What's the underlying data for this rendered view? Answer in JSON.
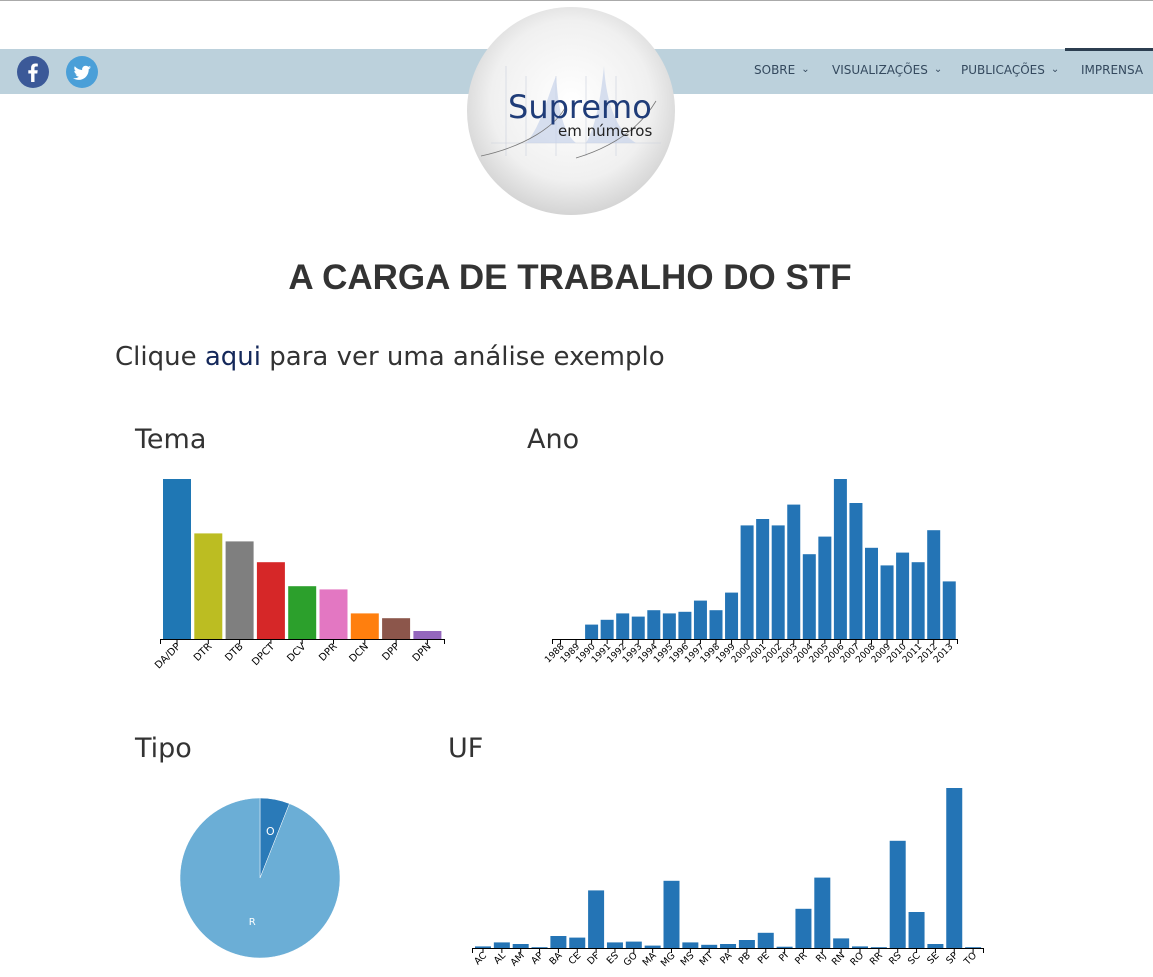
{
  "header": {
    "social": [
      {
        "name": "facebook"
      },
      {
        "name": "twitter"
      }
    ],
    "nav": [
      {
        "label": "SOBRE",
        "has_dropdown": true
      },
      {
        "label": "VISUALIZAÇÕES",
        "has_dropdown": true
      },
      {
        "label": "PUBLICAÇÕES",
        "has_dropdown": true
      },
      {
        "label": "IMPRENSA",
        "has_dropdown": false
      }
    ],
    "logo": {
      "line1": "Supremo",
      "line2": "em números"
    },
    "colors": {
      "navbar": "#bcd1dc",
      "nav_text": "#34495e",
      "facebook": "#3b5998",
      "twitter": "#4a9fd8"
    }
  },
  "page": {
    "title": "A CARGA DE TRABALHO DO STF",
    "intro_before": "Clique ",
    "intro_link": "aqui",
    "intro_after": " para ver uma análise exemplo"
  },
  "chart_data": [
    {
      "type": "bar",
      "title": "Tema",
      "categories": [
        "DA/DP",
        "DTR",
        "DTB",
        "DPCT",
        "DCV",
        "DPR",
        "DCN",
        "DPP",
        "DPN"
      ],
      "values": [
        100,
        66,
        61,
        48,
        33,
        31,
        16,
        13,
        5
      ],
      "colors": [
        "#1f77b4",
        "#bcbd22",
        "#7f7f7f",
        "#d62728",
        "#2ca02c",
        "#e377c2",
        "#ff7f0e",
        "#8c564b",
        "#9467bd"
      ],
      "ylim": [
        0,
        100
      ]
    },
    {
      "type": "bar",
      "title": "Ano",
      "categories": [
        "1988",
        "1989",
        "1990",
        "1991",
        "1992",
        "1993",
        "1994",
        "1995",
        "1996",
        "1997",
        "1998",
        "1999",
        "2000",
        "2001",
        "2002",
        "2003",
        "2004",
        "2005",
        "2006",
        "2007",
        "2008",
        "2009",
        "2010",
        "2011",
        "2012",
        "2013"
      ],
      "values": [
        0,
        0,
        9,
        12,
        16,
        14,
        18,
        16,
        17,
        24,
        18,
        29,
        71,
        75,
        71,
        84,
        53,
        64,
        100,
        85,
        57,
        46,
        54,
        48,
        68,
        36
      ],
      "color": "#2474b5",
      "ylim": [
        0,
        100
      ]
    },
    {
      "type": "pie",
      "title": "Tipo",
      "labels": [
        "O",
        "R"
      ],
      "values": [
        6,
        94
      ],
      "colors": [
        "#2a7ab8",
        "#6baed6"
      ]
    },
    {
      "type": "bar",
      "title": "UF",
      "categories": [
        "AC",
        "AL",
        "AM",
        "AP",
        "BA",
        "CE",
        "DF",
        "ES",
        "GO",
        "MA",
        "MG",
        "MS",
        "MT",
        "PA",
        "PB",
        "PE",
        "PI",
        "PR",
        "RJ",
        "RN",
        "RO",
        "RR",
        "RS",
        "SC",
        "SE",
        "SP",
        "TO"
      ],
      "values": [
        1,
        3.5,
        2.5,
        0.5,
        7.5,
        6.5,
        36,
        3.5,
        4,
        1.5,
        42,
        3.5,
        2,
        2.5,
        5,
        9.5,
        0.8,
        24.5,
        44,
        6,
        1,
        0.5,
        67,
        22.5,
        2.5,
        100,
        0.5
      ],
      "color": "#2474b5",
      "ylim": [
        0,
        100
      ]
    }
  ]
}
